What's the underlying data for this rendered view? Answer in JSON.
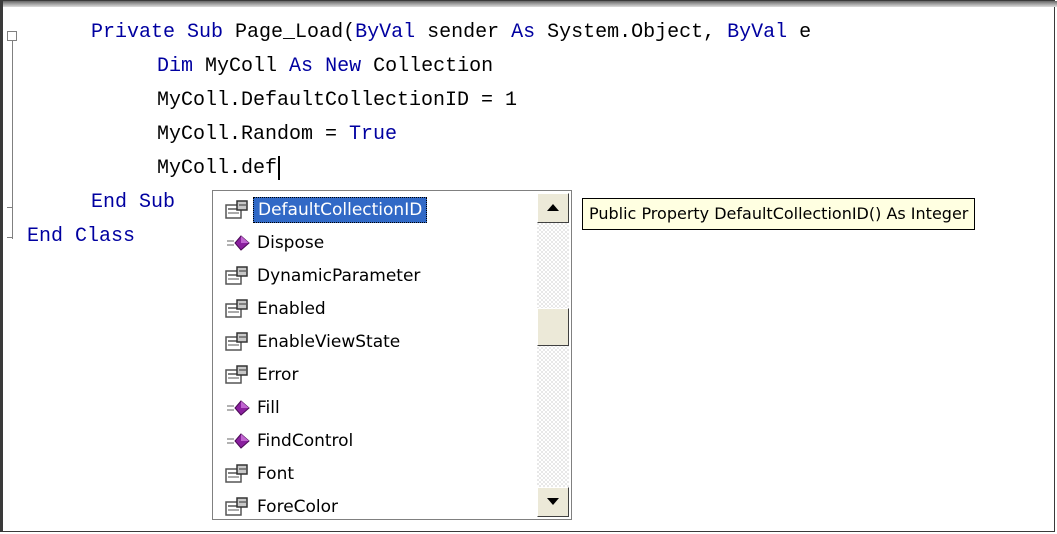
{
  "code_lines": [
    [
      {
        "t": "Private",
        "k": true
      },
      {
        "t": " "
      },
      {
        "t": "Sub",
        "k": true
      },
      {
        "t": " Page_Load("
      },
      {
        "t": "ByVal",
        "k": true
      },
      {
        "t": " sender "
      },
      {
        "t": "As",
        "k": true
      },
      {
        "t": " System.Object, "
      },
      {
        "t": "ByVal",
        "k": true
      },
      {
        "t": " e"
      }
    ],
    [
      {
        "t": "Dim",
        "k": true
      },
      {
        "t": " MyColl "
      },
      {
        "t": "As",
        "k": true
      },
      {
        "t": " "
      },
      {
        "t": "New",
        "k": true
      },
      {
        "t": " Collection"
      }
    ],
    [
      {
        "t": "MyColl.DefaultCollectionID = 1"
      }
    ],
    [
      {
        "t": "MyColl.Random = "
      },
      {
        "t": "True",
        "k": true
      }
    ],
    [
      {
        "t": "MyColl.def"
      }
    ],
    [
      {
        "t": "End",
        "k": true
      },
      {
        "t": " "
      },
      {
        "t": "Sub",
        "k": true
      }
    ],
    [
      {
        "t": "End",
        "k": true
      },
      {
        "t": " "
      },
      {
        "t": "Class",
        "k": true
      }
    ]
  ],
  "intellisense": {
    "items": [
      {
        "label": "DefaultCollectionID",
        "icon": "property-icon",
        "selected": true
      },
      {
        "label": "Dispose",
        "icon": "method-icon"
      },
      {
        "label": "DynamicParameter",
        "icon": "property-icon"
      },
      {
        "label": "Enabled",
        "icon": "property-icon"
      },
      {
        "label": "EnableViewState",
        "icon": "property-icon"
      },
      {
        "label": "Error",
        "icon": "property-icon"
      },
      {
        "label": "Fill",
        "icon": "method-icon"
      },
      {
        "label": "FindControl",
        "icon": "method-icon"
      },
      {
        "label": "Font",
        "icon": "property-icon"
      },
      {
        "label": "ForeColor",
        "icon": "property-icon"
      }
    ],
    "scroll_up_icon": "scroll-up-arrow-icon",
    "scroll_down_icon": "scroll-down-arrow-icon"
  },
  "tooltip": "Public Property DefaultCollectionID() As Integer",
  "colors": {
    "keyword": "#0000a0",
    "selection": "#3169c6",
    "tooltip_bg": "#ffffe1"
  }
}
